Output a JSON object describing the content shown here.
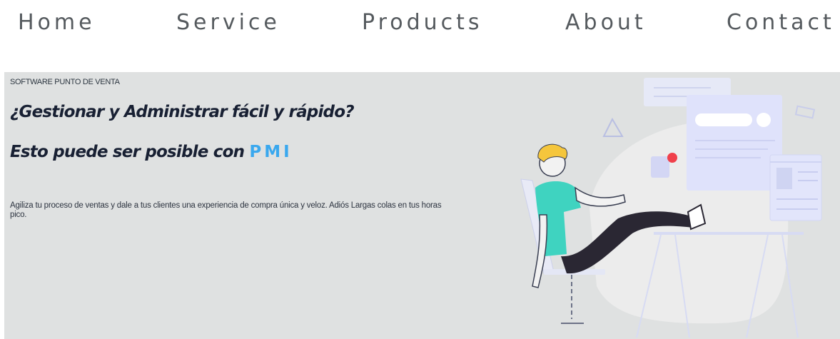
{
  "nav": {
    "home": "Home",
    "service": "Service",
    "products": "Products",
    "about": "About",
    "contact": "Contact"
  },
  "hero": {
    "eyebrow": "SOFTWARE PUNTO DE VENTA",
    "headline_1": "¿Gestionar y Administrar fácil y rápido?",
    "headline_2_prefix": "Esto puede ser posible con ",
    "brand": "PMI",
    "description": "Agiliza tu proceso de ventas y dale a tus clientes una experiencia de compra única y veloz. Adiós Largas colas en tus horas pico."
  },
  "colors": {
    "background": "#dfe1e1",
    "brand": "#3aa8ee",
    "headline": "#182033",
    "nav_text": "#555a5e",
    "shirt": "#3fd3c0",
    "hair": "#f5c63c",
    "pants": "#2a2733",
    "notification": "#f0404a"
  }
}
